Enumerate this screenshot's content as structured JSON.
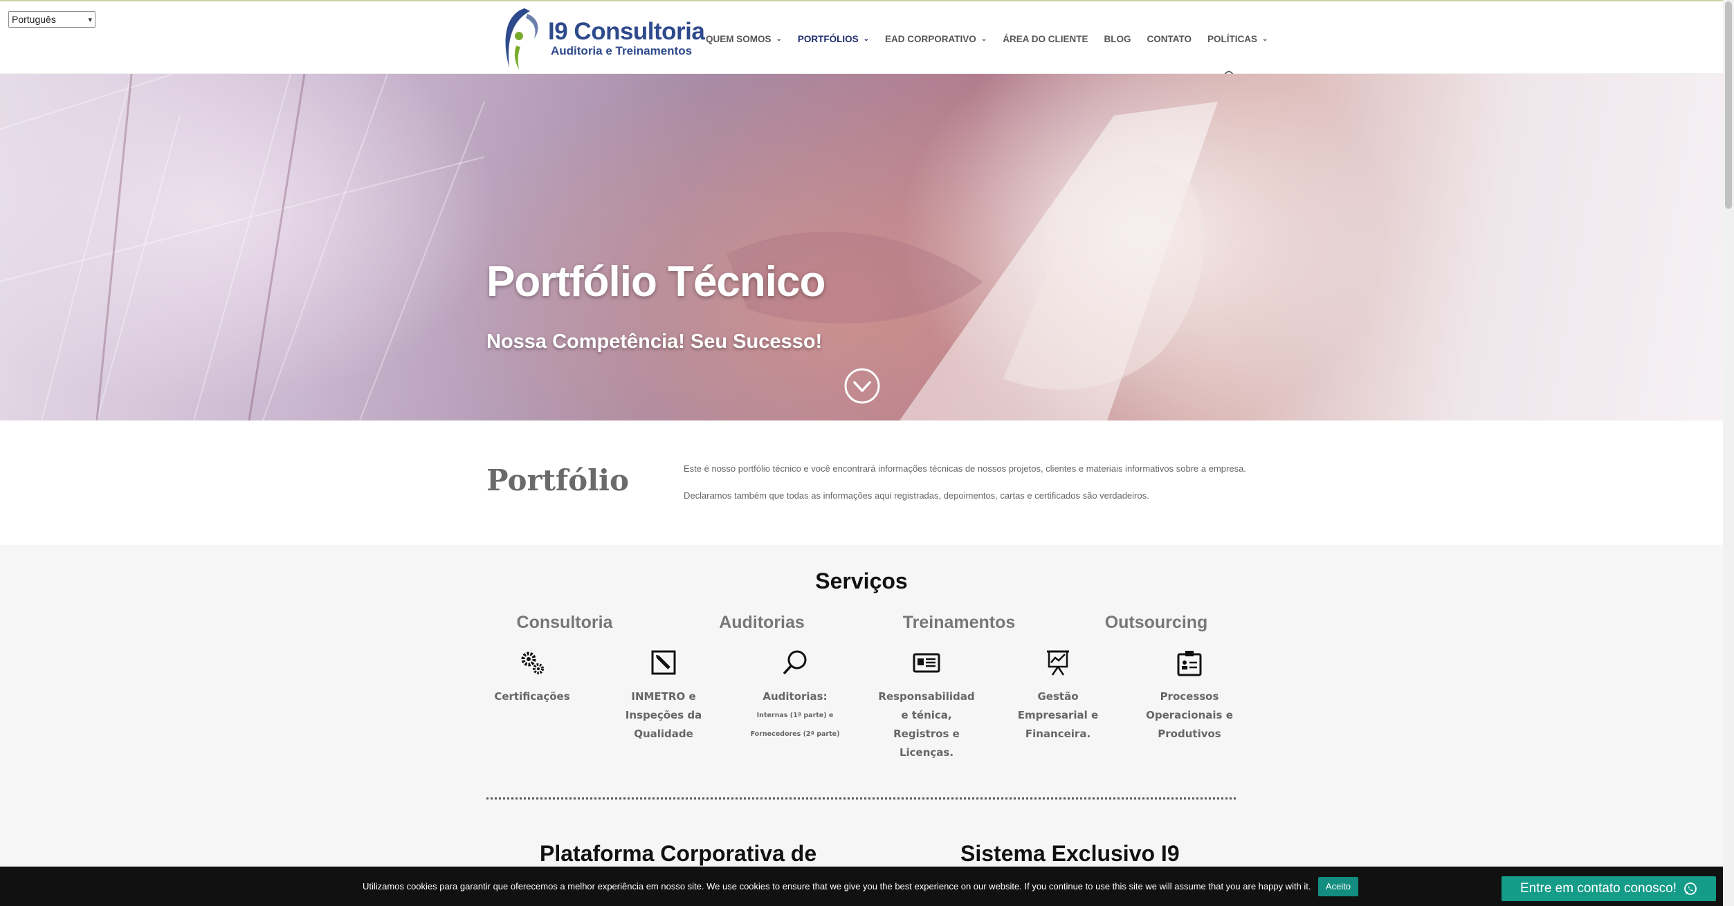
{
  "language_select": {
    "value": "Português"
  },
  "logo": {
    "title": "I9 Consultoria",
    "subtitle": "Auditoria e Treinamentos"
  },
  "nav": {
    "items": [
      {
        "label": "QUEM SOMOS",
        "dropdown": true
      },
      {
        "label": "PORTFÓLIOS",
        "dropdown": true,
        "active": true
      },
      {
        "label": "EAD CORPORATIVO",
        "dropdown": true
      },
      {
        "label": "ÁREA DO CLIENTE",
        "dropdown": false
      },
      {
        "label": "BLOG",
        "dropdown": false
      },
      {
        "label": "CONTATO",
        "dropdown": false
      },
      {
        "label": "POLÍTICAS",
        "dropdown": true
      }
    ],
    "search_icon": "search-icon"
  },
  "hero": {
    "title": "Portfólio Técnico",
    "subtitle": "Nossa Competência! Seu Sucesso!",
    "scroll_icon": "chevron-down-circle-icon"
  },
  "intro": {
    "heading": "Portfólio",
    "p1": "Este é nosso portfólio técnico e você encontrará informações técnicas de nossos projetos, clientes e materiais informativos sobre a empresa.",
    "p2": "Declaramos também que todas as informações aqui registradas, depoimentos, cartas e certificados são verdadeiros."
  },
  "services": {
    "title": "Serviços",
    "categories": [
      "Consultoria",
      "Auditorias",
      "Treinamentos",
      "Outsourcing"
    ],
    "items": [
      {
        "icon": "gears-icon",
        "lines": [
          "Certificações"
        ]
      },
      {
        "icon": "edit-icon",
        "lines": [
          "INMETRO e",
          "Inspeções da",
          "Qualidade"
        ]
      },
      {
        "icon": "magnifier-icon",
        "lines": [
          "Auditorias:"
        ],
        "small": [
          "Internas (1ª parte) e",
          "Fornecedores (2ª parte)"
        ]
      },
      {
        "icon": "id-card-icon",
        "lines": [
          "Responsabilidad",
          "e ténica,",
          "Registros e",
          "Licenças."
        ]
      },
      {
        "icon": "presentation-chart-icon",
        "lines": [
          "Gestão",
          "Empresarial e",
          "Financeira."
        ]
      },
      {
        "icon": "clipboard-icon",
        "lines": [
          "Processos",
          "Operacionais e",
          "Produtivos"
        ]
      }
    ],
    "bottom_left": "Plataforma Corporativa de",
    "bottom_right": "Sistema Exclusivo I9"
  },
  "cookie": {
    "text": "Utilizamos cookies para garantir que oferecemos a melhor experiência em nosso site. We use cookies to ensure that we give you the best experience on our website. If you continue to use this site we will assume that you are happy with it.",
    "accept": "Aceito"
  },
  "whatsapp": {
    "label": "Entre em contato conosco!",
    "icon": "whatsapp-icon"
  },
  "colors": {
    "brand": "#2e4a8c",
    "nav_active": "#1f2d6b",
    "accent_green": "#159c88"
  }
}
